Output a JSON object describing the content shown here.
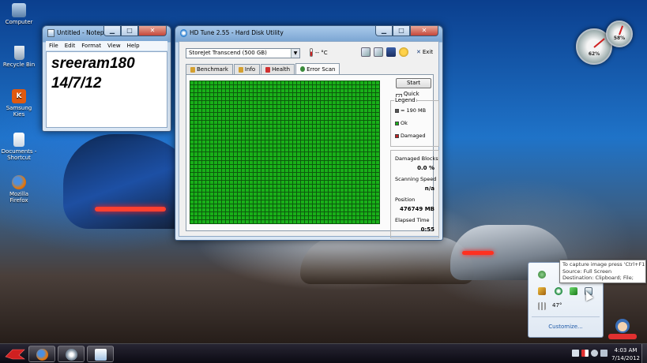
{
  "desktop": {
    "icons": [
      {
        "label": "Computer"
      },
      {
        "label": "Recycle Bin"
      },
      {
        "label": "Samsung Kies"
      },
      {
        "label": "Documents - Shortcut"
      },
      {
        "label": "Mozilla Firefox"
      }
    ]
  },
  "notepad": {
    "title": "Untitled - Notepad",
    "menu": [
      "File",
      "Edit",
      "Format",
      "View",
      "Help"
    ],
    "lines": [
      "sreeram180",
      "14/7/12"
    ]
  },
  "hdtune": {
    "title": "HD Tune 2.55 - Hard Disk Utility",
    "drive": "StoreJet Transcend",
    "drive_size": "(500 GB)",
    "temperature": "-- °C",
    "exit_label": "Exit",
    "tabs": [
      "Benchmark",
      "Info",
      "Health",
      "Error Scan"
    ],
    "active_tab": "Error Scan",
    "start_label": "Start",
    "quick_scan_label": "Quick Scan",
    "quick_scan_checked": true,
    "legend": {
      "title": "Legend",
      "block_size": "= 190 MB",
      "ok": "Ok",
      "damaged": "Damaged",
      "ok_color": "#19b019",
      "damaged_color": "#c02020"
    },
    "stats": {
      "damaged_blocks_label": "Damaged Blocks",
      "damaged_blocks_value": "0.0 %",
      "scanning_speed_label": "Scanning Speed",
      "scanning_speed_value": "n/a",
      "position_label": "Position",
      "position_value": "476749 MB",
      "elapsed_label": "Elapsed Time",
      "elapsed_value": "0:55"
    }
  },
  "gadgets": {
    "cpu_percent": "62%",
    "ram_percent": "58%"
  },
  "tray_overflow": {
    "temperature": "47°",
    "customize_label": "Customize..."
  },
  "tooltip": {
    "line1": "To capture image press 'Ctrl+F1'",
    "line2": "Source:  Full Screen",
    "line3": "Destination:  Clipboard; File;"
  },
  "taskbar": {
    "time": "4:03 AM",
    "date": "7/14/2012"
  },
  "colors": {
    "scan_ok": "#19b019",
    "scan_grid": "#0d5a0d"
  }
}
